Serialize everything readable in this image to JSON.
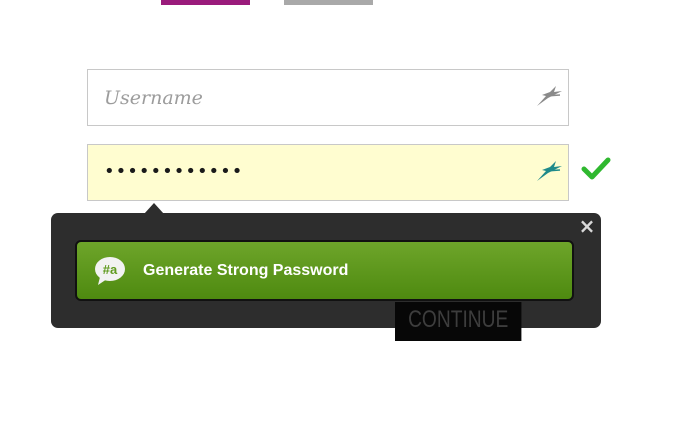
{
  "tabs": {
    "active_color": "#9a1b7b",
    "inactive_color": "#a9a9a9"
  },
  "form": {
    "username": {
      "placeholder": "Username",
      "value": ""
    },
    "password": {
      "value": "••••••••••••",
      "valid": true
    }
  },
  "popup": {
    "close_label": "×",
    "generate_label": "Generate Strong Password",
    "badge_text": "#a",
    "accent_color": "#5f9a1e"
  },
  "actions": {
    "continue_label": "CONTINUE"
  },
  "icons": {
    "field_icon": "dashlane-bird-icon",
    "validation_icon": "checkmark-icon",
    "close_icon": "close-icon",
    "badge_icon": "password-generator-icon"
  }
}
